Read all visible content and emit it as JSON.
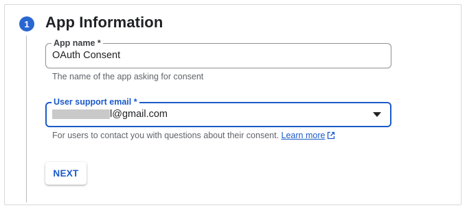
{
  "step": {
    "number": "1",
    "title": "App Information"
  },
  "app_name_field": {
    "label": "App name *",
    "value": "OAuth Consent",
    "helper": "The name of the app asking for consent"
  },
  "support_email_field": {
    "label": "User support email *",
    "value_visible": "l@gmail.com",
    "helper": "For users to contact you with questions about their consent.",
    "learn_more": "Learn more",
    "icon": "chevron-down-icon"
  },
  "actions": {
    "next_label": "NEXT"
  },
  "colors": {
    "accent": "#1a59c9",
    "badge": "#2a66d1"
  }
}
